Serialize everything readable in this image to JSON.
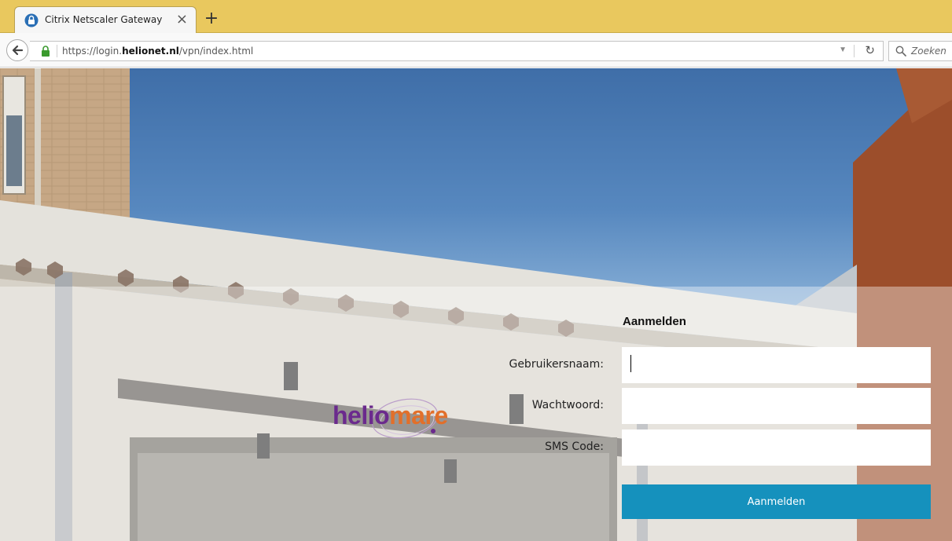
{
  "browser": {
    "tab_title": "Citrix Netscaler Gateway",
    "tab_close": "×",
    "new_tab": "+",
    "url_prefix": "https://login.",
    "url_domain": "helionet.nl",
    "url_path": "/vpn/index.html",
    "search_placeholder": "Zoeken"
  },
  "login": {
    "title": "Aanmelden",
    "username_label": "Gebruikersnaam:",
    "username_value": "",
    "password_label": "Wachtwoord:",
    "password_value": "",
    "sms_label": "SMS Code:",
    "sms_value": "",
    "submit_label": "Aanmelden"
  },
  "logo": {
    "part1": "helio",
    "part2": "mare"
  },
  "colors": {
    "tab_bar": "#e9c85e",
    "submit_button": "#1591bd",
    "logo_purple": "#6b2a8d",
    "logo_orange": "#e26f2a"
  },
  "icons": [
    "citrix-tab-icon",
    "close-icon",
    "plus-icon",
    "back-arrow-icon",
    "lock-icon",
    "dropdown-arrow-icon",
    "reload-icon",
    "search-icon"
  ]
}
